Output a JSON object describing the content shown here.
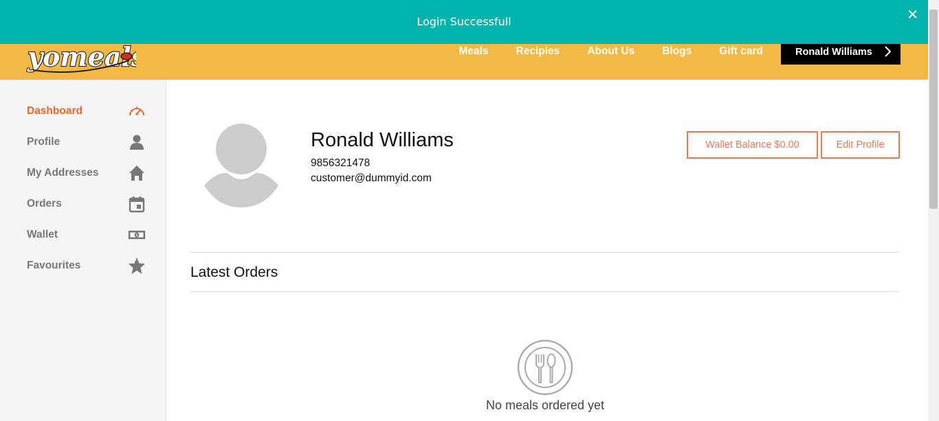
{
  "toast": {
    "message": "Login Successfull"
  },
  "header": {
    "brand": "yomeals",
    "nav": [
      "Meals",
      "Recipies",
      "About Us",
      "Blogs",
      "Gift card"
    ],
    "user_button": "Ronald Williams"
  },
  "sidebar": {
    "items": [
      {
        "label": "Dashboard",
        "icon": "speedometer-icon",
        "active": true
      },
      {
        "label": "Profile",
        "icon": "user-icon"
      },
      {
        "label": "My Addresses",
        "icon": "home-icon"
      },
      {
        "label": "Orders",
        "icon": "calendar-icon"
      },
      {
        "label": "Wallet",
        "icon": "money-icon"
      },
      {
        "label": "Favourites",
        "icon": "star-icon"
      }
    ]
  },
  "profile": {
    "name": "Ronald Williams",
    "phone": "9856321478",
    "email": "customer@dummyid.com",
    "wallet_button": "Wallet Balance $0.00",
    "edit_button": "Edit Profile"
  },
  "orders": {
    "title": "Latest Orders",
    "empty_message": "No meals ordered yet"
  },
  "colors": {
    "accent": "#e9672e",
    "header": "#f4b942",
    "toast": "#00b3ac"
  }
}
